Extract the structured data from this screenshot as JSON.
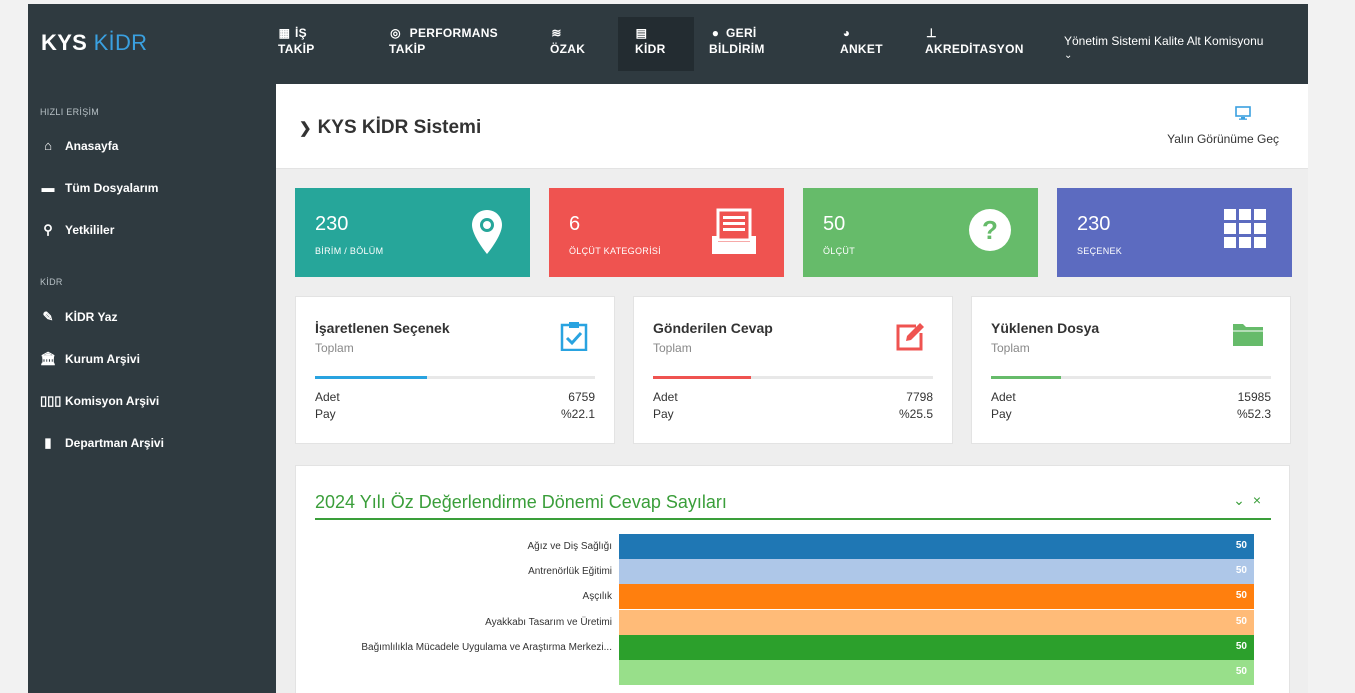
{
  "brand": {
    "strong": "KYS",
    "accent": "KİDR"
  },
  "nav": [
    {
      "icon": "calendar-icon",
      "glyph": "📅",
      "l1": "İŞ",
      "l2": "TAKİP"
    },
    {
      "icon": "target-icon",
      "glyph": "◎",
      "l1": "PERFORMANS",
      "l2": "TAKİP"
    },
    {
      "icon": "layers-icon",
      "glyph": "❖",
      "l1": "",
      "l2": "ÖZAK"
    },
    {
      "icon": "clipboard-icon",
      "glyph": "📋",
      "l1": "",
      "l2": "KİDR"
    },
    {
      "icon": "comment-icon",
      "glyph": "💬",
      "l1": "GERİ",
      "l2": "BİLDİRİM"
    },
    {
      "icon": "pie-chart-icon",
      "glyph": "◕",
      "l1": "",
      "l2": "ANKET"
    },
    {
      "icon": "stamp-icon",
      "glyph": "⊥",
      "l1": "",
      "l2": "AKREDİTASYON"
    }
  ],
  "department": "Yönetim Sistemi Kalite Alt Komisyonu",
  "sidebar": {
    "section1": "HIZLI ERİŞİM",
    "items1": [
      {
        "label": "Anasayfa"
      },
      {
        "label": "Tüm Dosyalarım"
      },
      {
        "label": "Yetkililer"
      }
    ],
    "section2": "KİDR",
    "items2": [
      {
        "label": "KİDR Yaz"
      },
      {
        "label": "Kurum Arşivi"
      },
      {
        "label": "Komisyon Arşivi"
      },
      {
        "label": "Departman Arşivi"
      }
    ]
  },
  "page": {
    "title": "KYS KİDR Sistemi",
    "view_switch": "Yalın Görünüme Geç"
  },
  "stats": [
    {
      "value": "230",
      "label": "BİRİM / BÖLÜM",
      "color": "#26a69a",
      "icon": "map-marker-icon"
    },
    {
      "value": "6",
      "label": "ÖLÇÜT KATEGORİSİ",
      "color": "#ef5350",
      "icon": "inbox-list-icon"
    },
    {
      "value": "50",
      "label": "ÖLÇÜT",
      "color": "#66bb6a",
      "icon": "question-circle-icon"
    },
    {
      "value": "230",
      "label": "SEÇENEK",
      "color": "#5c6bc0",
      "icon": "grid-icon"
    }
  ],
  "cards": [
    {
      "title": "İşaretlenen Seçenek",
      "subtitle": "Toplam",
      "count_label": "Adet",
      "count": "6759",
      "share_label": "Pay",
      "share": "%22.1",
      "progress": 0.4,
      "color": "#29a3e0",
      "icon": "clipboard-check-icon"
    },
    {
      "title": "Gönderilen Cevap",
      "subtitle": "Toplam",
      "count_label": "Adet",
      "count": "7798",
      "share_label": "Pay",
      "share": "%25.5",
      "progress": 0.35,
      "color": "#ef5350",
      "icon": "edit-square-icon"
    },
    {
      "title": "Yüklenen Dosya",
      "subtitle": "Toplam",
      "count_label": "Adet",
      "count": "15985",
      "share_label": "Pay",
      "share": "%52.3",
      "progress": 0.25,
      "color": "#66bb6a",
      "icon": "folder-icon"
    }
  ],
  "chart_data": {
    "type": "bar",
    "orientation": "horizontal",
    "title": "2024 Yılı Öz Değerlendirme Dönemi Cevap Sayıları",
    "categories": [
      "Ağız ve Diş Sağlığı",
      "Antrenörlük Eğitimi",
      "Aşçılık",
      "Ayakkabı Tasarım ve Üretimi",
      "Bağımlılıkla Mücadele Uygulama ve Araştırma Merkezi...",
      ""
    ],
    "values": [
      50,
      50,
      50,
      50,
      50,
      50
    ],
    "colors": [
      "#1f77b4",
      "#aec7e8",
      "#ff7f0e",
      "#ffbb78",
      "#2ca02c",
      "#98df8a"
    ],
    "xlim": [
      0,
      50
    ],
    "grid": false
  }
}
